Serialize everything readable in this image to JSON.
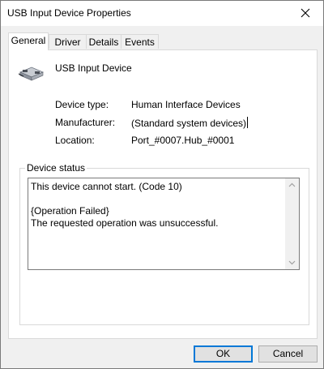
{
  "window": {
    "title": "USB Input Device Properties"
  },
  "tabs": [
    {
      "label": "General",
      "active": true
    },
    {
      "label": "Driver",
      "active": false
    },
    {
      "label": "Details",
      "active": false
    },
    {
      "label": "Events",
      "active": false
    }
  ],
  "device": {
    "icon": "usb-device-icon",
    "name": "USB Input Device"
  },
  "properties": {
    "type_label": "Device type:",
    "type_value": "Human Interface Devices",
    "manufacturer_label": "Manufacturer:",
    "manufacturer_value": "(Standard system devices)",
    "location_label": "Location:",
    "location_value": "Port_#0007.Hub_#0001"
  },
  "status": {
    "legend": "Device status",
    "text": "This device cannot start. (Code 10)\n\n{Operation Failed}\nThe requested operation was unsuccessful."
  },
  "buttons": {
    "ok": "OK",
    "cancel": "Cancel"
  },
  "colors": {
    "accent": "#0078d7",
    "window_bg": "#f0f0f0",
    "panel_bg": "#ffffff"
  }
}
